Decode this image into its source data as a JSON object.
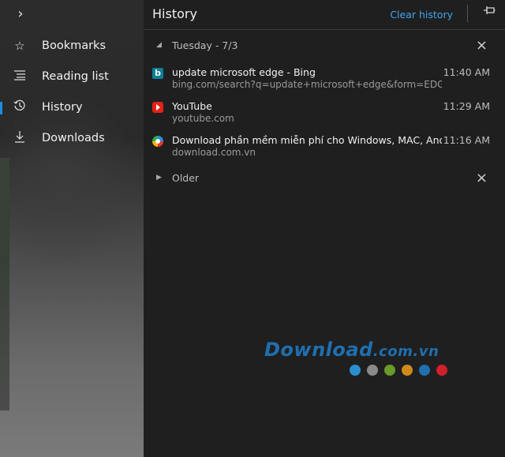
{
  "nav": {
    "toggle_icon": "chevron-right-icon",
    "items": [
      {
        "label": "Bookmarks",
        "icon": "star-icon"
      },
      {
        "label": "Reading list",
        "icon": "reading-list-icon"
      },
      {
        "label": "History",
        "icon": "history-icon",
        "active": true
      },
      {
        "label": "Downloads",
        "icon": "download-icon"
      }
    ]
  },
  "panel": {
    "title": "History",
    "clear_label": "Clear history",
    "pin_icon": "pin-icon"
  },
  "groups": [
    {
      "label": "Tuesday - 7/3",
      "expanded": true,
      "entries": [
        {
          "title": "update microsoft edge - Bing",
          "url": "bing.com/search?q=update+microsoft+edge&form=EDGTCT&qs=",
          "time": "11:40 AM",
          "favicon": "bing-icon"
        },
        {
          "title": "YouTube",
          "url": "youtube.com",
          "time": "11:29 AM",
          "favicon": "youtube-icon"
        },
        {
          "title": "Download phần mềm miễn phí cho Windows, MAC, Android, iOS, W",
          "url": "download.com.vn",
          "time": "11:16 AM",
          "favicon": "download-com-vn-icon"
        }
      ]
    },
    {
      "label": "Older",
      "expanded": false,
      "entries": []
    }
  ],
  "watermark": {
    "text": "Download",
    "suffix": ".com.vn",
    "dot_colors": [
      "#2a8fd0",
      "#8a8a8a",
      "#6a9a2a",
      "#d08a1a",
      "#1f6fb0",
      "#d0202a"
    ]
  },
  "colors": {
    "accent": "#3ea6f5",
    "active_indicator": "#1a8fe0",
    "background": "#1f1f1f"
  }
}
